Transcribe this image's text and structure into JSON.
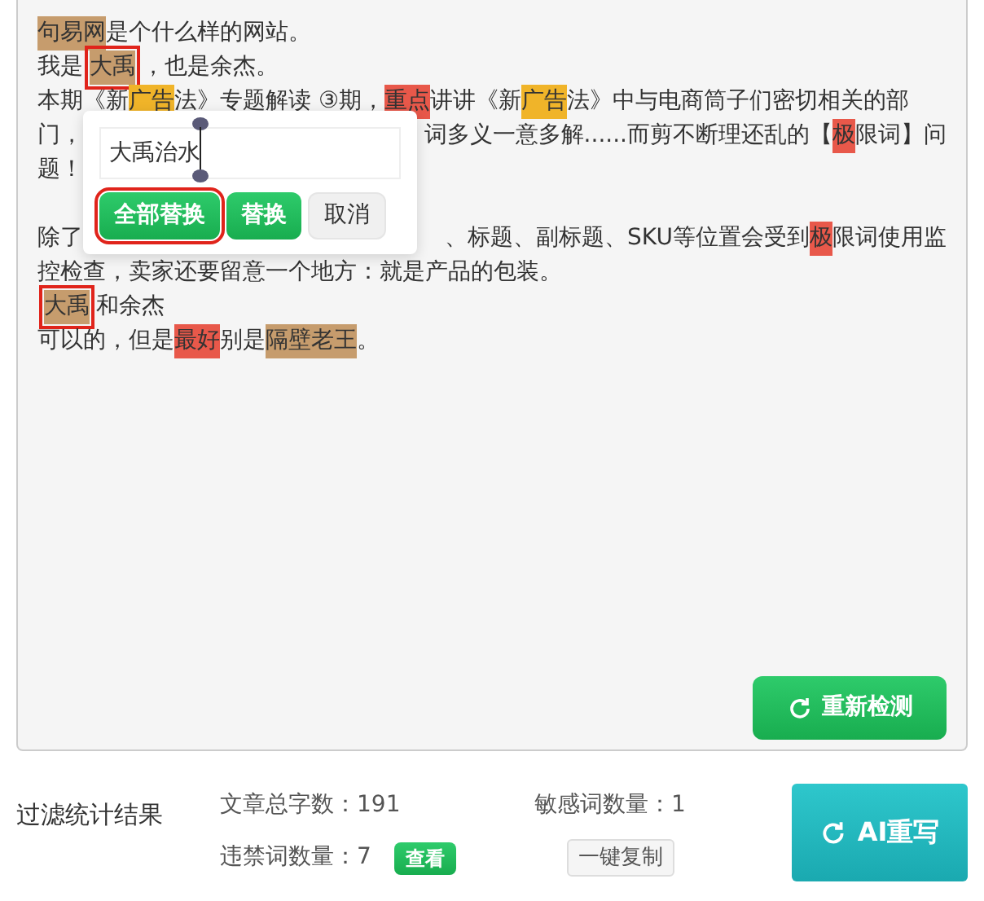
{
  "editor": {
    "lines": [
      {
        "parts": [
          [
            {
              "text": "句易网",
              "color": "#c69c6d"
            },
            {
              "text": "是个什么样的网站。"
            }
          ]
        ]
      },
      {
        "parts": [
          [
            {
              "text": "我是"
            },
            {
              "text": "大禹",
              "color": "#c69c6d",
              "outlined": true
            },
            {
              "text": "，也是余杰。"
            }
          ]
        ]
      },
      {
        "parts": [
          [
            {
              "text": "本期《新"
            },
            {
              "text": "广告",
              "color": "#f0b429"
            },
            {
              "text": "法》专题解读 ③期，"
            },
            {
              "text": "重点",
              "color": "#e8584a"
            },
            {
              "text": "讲讲《新"
            },
            {
              "text": "广告",
              "color": "#f0b429"
            },
            {
              "text": "法》中与电商筒子们密切相关的部"
            }
          ]
        ]
      },
      {
        "parts": [
          [
            {
              "text": "门，"
            }
          ],
          [
            {
              "text": "词多义一意多解......而剪不断理还乱的【"
            },
            {
              "text": "极",
              "color": "#e8584a"
            },
            {
              "text": "限词】问"
            }
          ]
        ]
      },
      {
        "parts": [
          [
            {
              "text": "题！"
            }
          ]
        ]
      },
      {
        "gap_before": true,
        "parts": [
          [
            {
              "text": "除了"
            }
          ],
          [
            {
              "text": "、标题、副标题、SKU等位置会受到"
            },
            {
              "text": "极",
              "color": "#e8584a"
            },
            {
              "text": "限词使用监"
            }
          ]
        ]
      },
      {
        "parts": [
          [
            {
              "text": "控检查，卖家还要留意一个地方：就是产品的包装。"
            }
          ]
        ]
      },
      {
        "parts": [
          [
            {
              "text": "大禹",
              "color": "#c69c6d",
              "outlined": true
            },
            {
              "text": "和余杰"
            }
          ]
        ]
      },
      {
        "parts": [
          [
            {
              "text": "可以的，但是"
            },
            {
              "text": "最好",
              "color": "#e8584a"
            },
            {
              "text": "别是"
            },
            {
              "text": "隔壁老王",
              "color": "#c69c6d"
            },
            {
              "text": "。"
            }
          ]
        ]
      }
    ]
  },
  "popup": {
    "value": "大禹治水",
    "buttons": [
      {
        "label": "全部替换",
        "kind": "primary",
        "outlined": true
      },
      {
        "label": "替换",
        "kind": "primary",
        "outlined": false
      },
      {
        "label": "取消",
        "kind": "secondary",
        "outlined": false
      }
    ]
  },
  "recheck_button": "重新检测",
  "stats": {
    "title": "过滤统计结果",
    "total_words": "文章总字数：191",
    "sensitive_count": "敏感词数量：1",
    "forbidden_count": "违禁词数量：7",
    "view_button": "查看",
    "copy_button": "一键复制"
  },
  "rewrite_button": "AI重写"
}
